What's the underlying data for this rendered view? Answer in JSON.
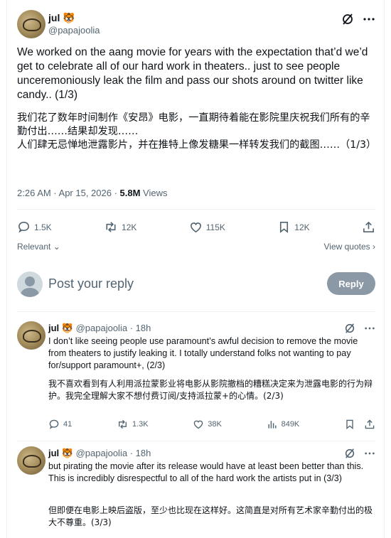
{
  "tweet": {
    "name": "jul 🐯",
    "handle": "@papajoolia",
    "text": "We worked on the aang movie for years with the expectation that’d we’d get to celebrate all of our hard work in theaters.. just to see people unceremoniously leak the film and pass our shots around on twitter like candy.. (1/3)",
    "translation": "我们花了数年时间制作《安昂》电影，一直期待着能在影院里庆祝我们所有的辛勤付出……结果却发现……\n人们肆无忌惮地泄露影片，并在推特上像发糖果一样转发我们的截图……（1/3）",
    "time": "2:26 AM · Apr 15, 2026 · ",
    "views_count": "5.8M",
    "views_label": " Views",
    "replies": "1.5K",
    "retweets": "12K",
    "likes": "115K",
    "bookmarks": "12K"
  },
  "sort": {
    "relevant": "Relevant",
    "view_quotes": "View quotes"
  },
  "compose": {
    "placeholder": "Post your reply",
    "reply_button": "Reply"
  },
  "replies": [
    {
      "name": "jul 🐯",
      "handle": "@papajoolia",
      "time": "18h",
      "text": "I don’t like seeing people use paramount’s awful decision to remove the movie from theaters to justify leaking it. I totally understand folks not wanting to pay for/support paramount+, (2/3)",
      "translation": "我不喜欢看到有人利用派拉蒙影业将电影从影院撤档的糟糕决定来为泄露电影的行为辩护。我完全理解大家不想付费订阅/支持派拉蒙+的心情。(2/3)",
      "replies": "41",
      "retweets": "1.3K",
      "likes": "38K",
      "views": "849K"
    },
    {
      "name": "jul 🐯",
      "handle": "@papajoolia",
      "time": "18h",
      "text": "but pirating the movie after its release would have at least been better than this. This is incredibly disrespectful to all of the hard work the artists put in (3/3)",
      "translation": "但即便在电影上映后盗版，至少也比现在这样好。这简直是对所有艺术家辛勤付出的极大不尊重。(3/3)"
    }
  ],
  "icons": {
    "grok": "grok-icon",
    "more": "more-icon",
    "reply": "reply-icon",
    "retweet": "retweet-icon",
    "like": "like-icon",
    "bookmark": "bookmark-icon",
    "share": "share-icon",
    "views": "views-icon"
  },
  "colors": {
    "text": "#0f1419",
    "muted": "#536471",
    "reply_button": "#8b98a5",
    "divider": "#eff3f4"
  }
}
